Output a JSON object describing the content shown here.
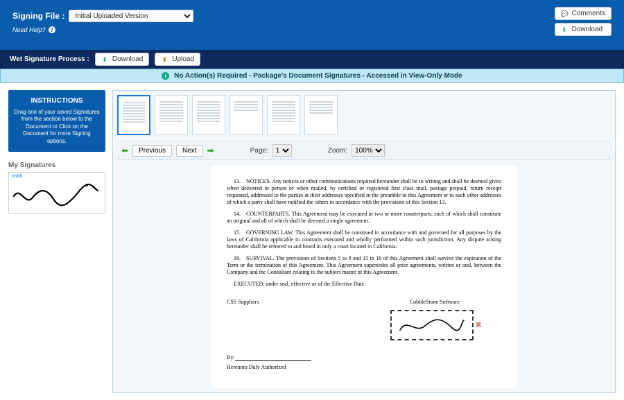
{
  "header": {
    "label": "Signing File :",
    "version_selected": "Initial Uploaded Version",
    "help": "Need Help?",
    "comments_label": "Comments",
    "download_label": "Download"
  },
  "wet_sig": {
    "label": "Wet Signature Process :",
    "download": "Download",
    "upload": "Upload"
  },
  "notification": "No Action(s) Required - Package's Document Signatures - Accessed in View-Only Mode",
  "side": {
    "instructions_title": "INSTRUCTIONS",
    "instructions_body": "Drag one of your saved Signatures from the section below to the Document or Click on the Document for more Signing options.",
    "my_sig_title": "My Signatures",
    "sig_name": "nnhh"
  },
  "viewer": {
    "prev": "Previous",
    "next": "Next",
    "page_label": "Page:",
    "page_value": "1",
    "zoom_label": "Zoom:",
    "zoom_value": "100%"
  },
  "doc": {
    "p13": "13. NOTICES.  Any notices or other communications required hereunder shall be in writing and shall be deemed given when delivered in person or when mailed, by certified or registered first class mail, postage prepaid, return receipt requested, addressed to the parties at their addresses specified in the preamble to this Agreement or to such other addresses of which a party shall have notified the others in accordance with the provisions of this Section 13.",
    "p14": "14. COUNTERPARTS.  This Agreement may be executed in two or more counterparts, each of which shall constitute an original and all of which shall be deemed a single agreement.",
    "p15": "15. GOVERNING LAW.  This Agreement shall be construed in accordance with and governed for all purposes by the laws of California applicable to contracts executed and wholly performed within such jurisdiction. Any dispute arising hereunder shall be referred to and heard in only a court located in California.",
    "p16": "16. SURVIVAL.  The provisions of Sections 5 to 9 and 15 to 16 of this Agreement shall survive the expiration of the Term or the termination of this Agreement.  This Agreement supersedes all prior agreements, written or oral, between the Company and the Consultant relating to the subject matter of this Agreement.",
    "exec": "EXECUTED, under seal, effective as of the Effective Date.",
    "party_a": "CSS Suppliers",
    "party_b": "CobbleStone Software",
    "by": "By:",
    "auth": "Hereunto Duly Authorized"
  }
}
